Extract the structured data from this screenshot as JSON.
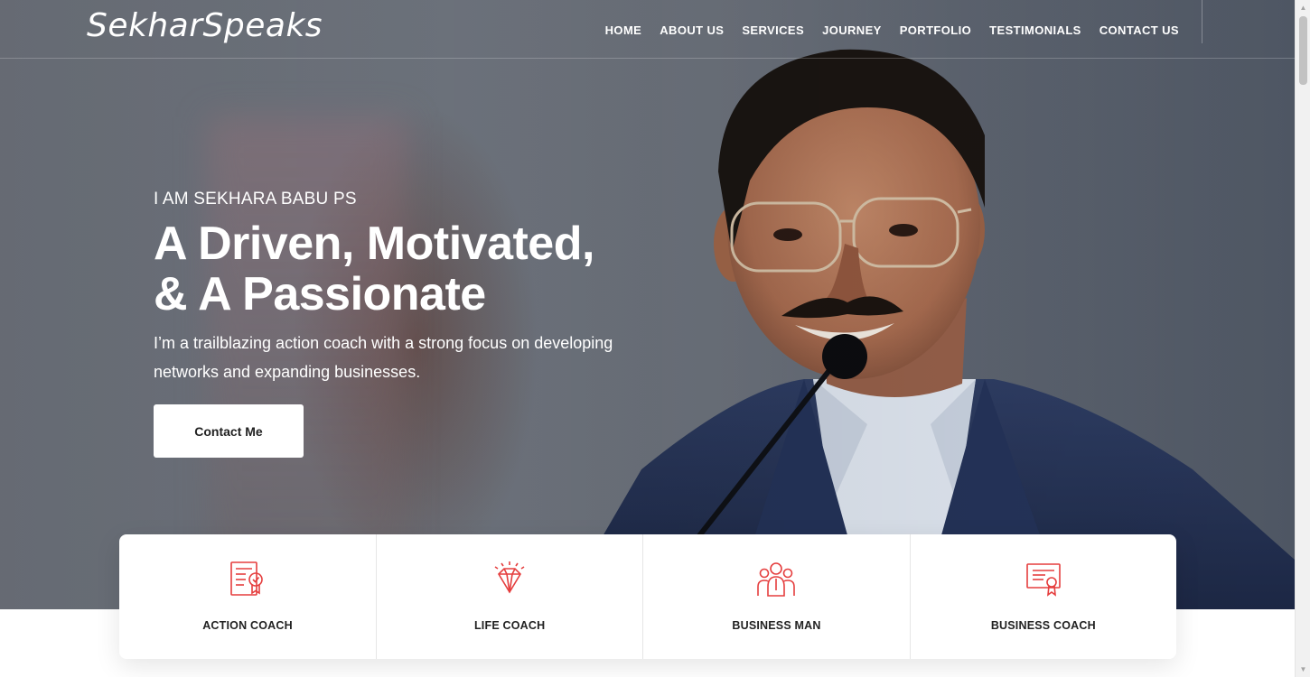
{
  "brand": {
    "logo": "SekharSpeaks"
  },
  "nav": {
    "items": [
      "HOME",
      "ABOUT US",
      "SERVICES",
      "JOURNEY",
      "PORTFOLIO",
      "TESTIMONIALS",
      "CONTACT US"
    ]
  },
  "hero": {
    "eyebrow": "I AM SEKHARA BABU PS",
    "headline_line1": "A Driven, Motivated,",
    "headline_line2": "& A Passionate",
    "subtext": "I’m a trailblazing action coach with a strong focus on developing networks and expanding businesses.",
    "cta_label": "Contact Me"
  },
  "features": [
    {
      "label": "ACTION COACH",
      "icon": "certificate-checklist-icon"
    },
    {
      "label": "LIFE COACH",
      "icon": "diamond-icon"
    },
    {
      "label": "BUSINESS MAN",
      "icon": "team-group-icon"
    },
    {
      "label": "BUSINESS COACH",
      "icon": "award-certificate-icon"
    }
  ],
  "colors": {
    "accent": "#e53e3e",
    "hero_text": "#ffffff",
    "card_text": "#222222"
  }
}
